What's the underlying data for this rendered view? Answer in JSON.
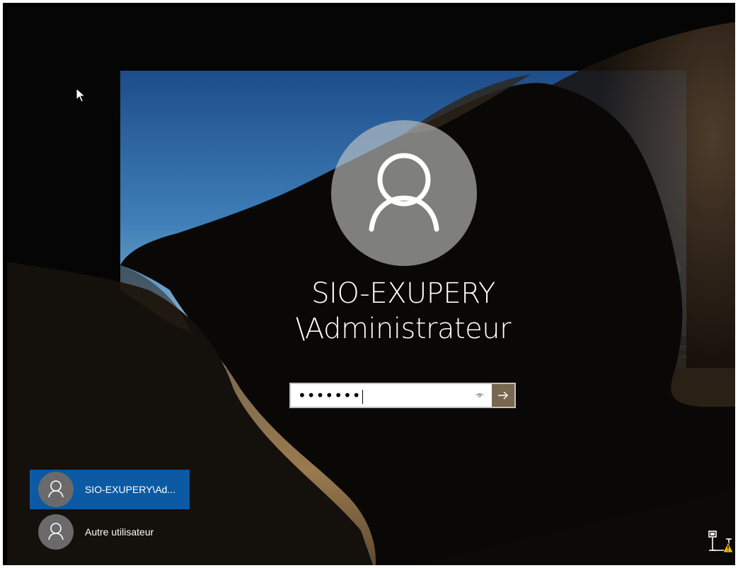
{
  "login": {
    "username_line1": "SIO-EXUPERY",
    "username_line2": "\\Administrateur",
    "password_value": "•••••••",
    "reveal_icon": "eye-icon",
    "submit_icon": "arrow-right-icon"
  },
  "users": [
    {
      "label": "SIO-EXUPERY\\Ad...",
      "icon": "user-icon",
      "selected": true
    },
    {
      "label": "Autre utilisateur",
      "icon": "user-icon",
      "selected": false
    }
  ],
  "tray": {
    "network_icon": "network-warning-icon"
  },
  "colors": {
    "selected_user_bg": "#0b5aa3",
    "submit_bg": "#8c785f",
    "warning": "#f5b800"
  }
}
